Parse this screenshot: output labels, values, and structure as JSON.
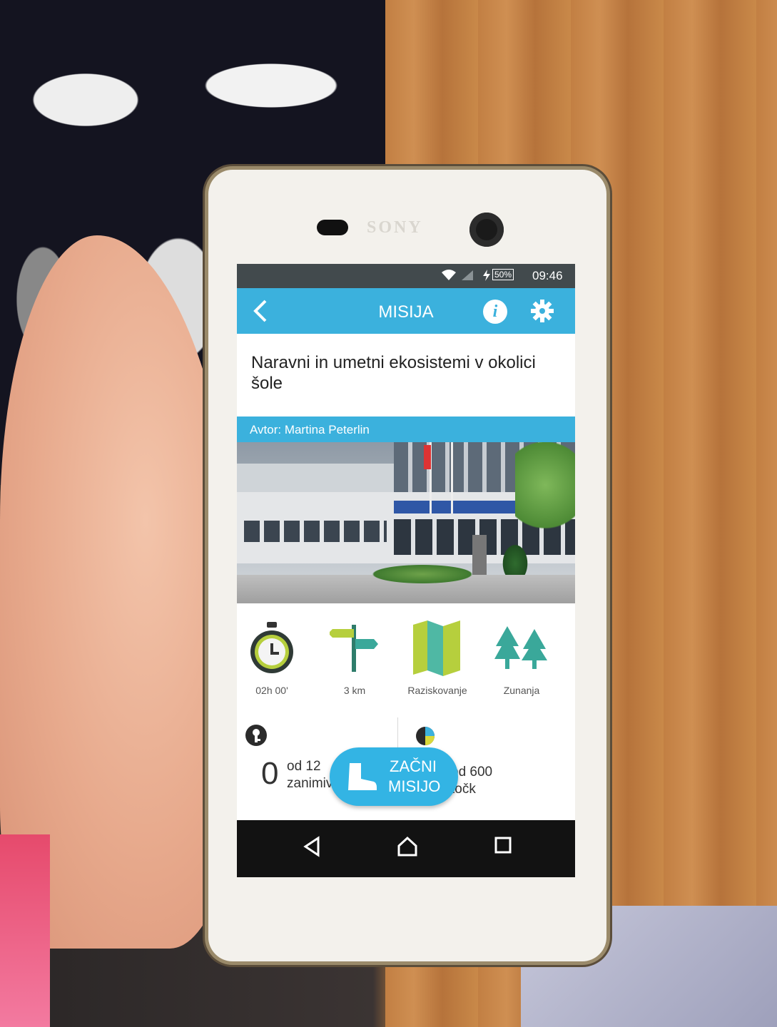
{
  "status_bar": {
    "battery": "50%",
    "time": "09:46"
  },
  "app_bar": {
    "title": "MISIJA",
    "info_label": "i"
  },
  "mission": {
    "title": "Naravni in umetni ekosistemi v okolici šole",
    "author": "Avtor: Martina Peterlin"
  },
  "stats": [
    {
      "icon": "stopwatch-icon",
      "label": "02h 00'"
    },
    {
      "icon": "signpost-icon",
      "label": "3 km"
    },
    {
      "icon": "map-icon",
      "label": "Raziskovanje"
    },
    {
      "icon": "trees-icon",
      "label": "Zunanja"
    }
  ],
  "progress": {
    "count": "0",
    "left_line1": "od 12",
    "left_line2": "zanimiv",
    "right_line1": "od 600",
    "right_line2": "točk"
  },
  "start_button": {
    "line1": "ZAČNI",
    "line2": "MISIJO"
  },
  "phone_brand": "SONY",
  "colors": {
    "accent": "#3bb1dd",
    "status_bar": "#424a4d",
    "navbar": "#121212"
  }
}
